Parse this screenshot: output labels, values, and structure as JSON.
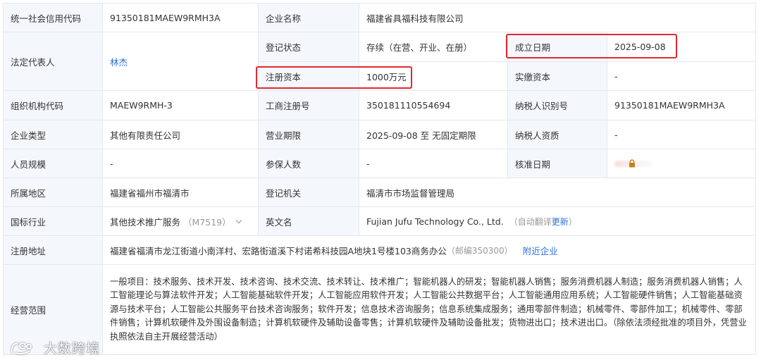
{
  "rows": {
    "credit_code": {
      "label": "统一社会信用代码",
      "value": "91350181MAEW9RMH3A"
    },
    "company_name": {
      "label": "企业名称",
      "value": "福建省具福科技有限公司"
    },
    "legal_rep": {
      "label": "法定代表人",
      "value": "林杰"
    },
    "reg_status": {
      "label": "登记状态",
      "value": "存续（在营、开业、在册）"
    },
    "found_date": {
      "label": "成立日期",
      "value": "2025-09-08"
    },
    "reg_capital": {
      "label": "注册资本",
      "value": "1000万元"
    },
    "paid_capital": {
      "label": "实缴资本",
      "value": "-"
    },
    "org_code": {
      "label": "组织机构代码",
      "value": "MAEW9RMH-3"
    },
    "biz_reg_no": {
      "label": "工商注册号",
      "value": "350181110554694"
    },
    "taxpayer_id": {
      "label": "纳税人识别号",
      "value": "91350181MAEW9RMH3A"
    },
    "company_type": {
      "label": "企业类型",
      "value": "其他有限责任公司"
    },
    "biz_term": {
      "label": "营业期限",
      "value": "2025-09-08 至 无固定期限"
    },
    "taxpayer_qual": {
      "label": "纳税人资质",
      "value": "-"
    },
    "staff_size": {
      "label": "人员规模",
      "value": "-"
    },
    "insured": {
      "label": "参保人数",
      "value": "-"
    },
    "approval_date": {
      "label": "核准日期",
      "value": "",
      "locked_hint": "VIP"
    },
    "region": {
      "label": "所属地区",
      "value": "福建省福州市福清市"
    },
    "reg_authority": {
      "label": "登记机关",
      "value": "福清市市场监督管理局"
    },
    "industry": {
      "label": "国标行业",
      "value": "其他技术推广服务",
      "code": "（M7519）"
    },
    "english_name": {
      "label": "英文名",
      "value": "Fujian Jufu Technology Co., Ltd.",
      "note": "（自动翻译",
      "note_link": "更新",
      "note_end": "）"
    },
    "address": {
      "label": "注册地址",
      "value": "福建省福清市龙江街道小南洋村、宏路街道溪下村诺希科技园A地块1号楼103商务办公",
      "postcode": "（邮编350300）",
      "nearby_link": "附近企业"
    },
    "scope": {
      "label": "经营范围",
      "value": "一般项目：技术服务、技术开发、技术咨询、技术交流、技术转让、技术推广；智能机器人的研发；智能机器人销售；服务消费机器人制造；服务消费机器人销售；人工智能理论与算法软件开发；人工智能基础软件开发；人工智能应用软件开发；人工智能公共数据平台；人工智能通用应用系统；人工智能硬件销售；人工智能基础资源与技术平台；人工智能公共服务平台技术咨询服务；软件开发；信息技术咨询服务；信息系统集成服务；通用零部件制造；机械零件、零部件加工；机械零件、零部件销售；计算机软硬件及外围设备制造；计算机软硬件及辅助设备零售；计算机软硬件及辅助设备批发；货物进出口；技术进出口。（除依法须经批准的项目外，凭营业执照依法自主开展经营活动）"
    }
  },
  "watermark": {
    "text": "大数跨境",
    "icon": "brand-logo-icon"
  },
  "icons": {
    "chevron": "chevron-down-icon",
    "lock": "lock-icon"
  },
  "colors": {
    "label_bg": "#f4f7fc",
    "border": "#e4e8ef",
    "link": "#2e6fd8",
    "highlight": "#e0282e",
    "lock": "#c8801a"
  }
}
